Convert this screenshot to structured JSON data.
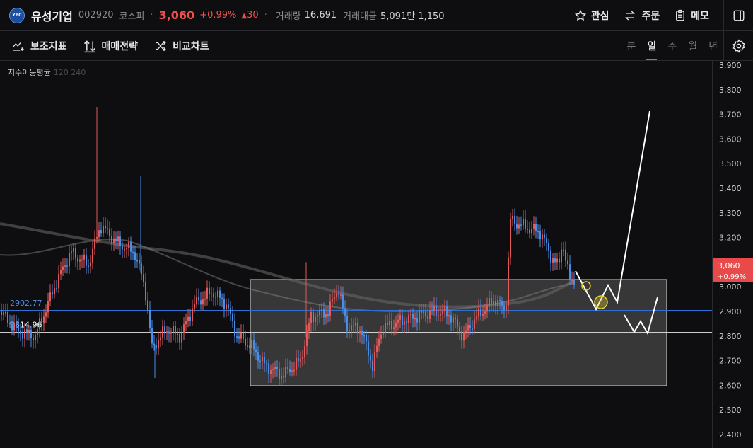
{
  "header": {
    "logo_text": "YPC",
    "name": "유성기업",
    "code": "002920",
    "market": "코스피",
    "price": "3,060",
    "change_pct": "+0.99%",
    "change_abs": "30",
    "volume_label": "거래량",
    "volume_value": "16,691",
    "amount_label": "거래대금",
    "amount_value": "5,091만 1,150",
    "actions": {
      "watch": "관심",
      "order": "주문",
      "memo": "메모"
    }
  },
  "toolbar": {
    "indicator": "보조지표",
    "strategy": "매매전략",
    "compare": "비교차트",
    "periods": [
      "분",
      "일",
      "주",
      "월",
      "년"
    ],
    "active_period": "일"
  },
  "chart": {
    "indicator_label": "지수이동평균",
    "ma_periods": "120 240",
    "y_ticks": [
      2400,
      2500,
      2600,
      2700,
      2800,
      2900,
      3000,
      3100,
      3200,
      3300,
      3400,
      3500,
      3600,
      3700,
      3800,
      3900
    ],
    "y_tick_labels": [
      "2,400",
      "2,500",
      "2,600",
      "2,700",
      "2,800",
      "2,900",
      "3,000",
      "3,100",
      "3,200",
      "3,300",
      "3,400",
      "3,500",
      "3,600",
      "3,700",
      "3,800",
      "3,900"
    ],
    "current_price_label": "3,060",
    "current_change_label": "+0.99%",
    "blue_line_value": 2902.77,
    "blue_line_label": "2902.77",
    "white_line_value": 2814.96,
    "white_line_label": "2814.96",
    "colors": {
      "up": "#e25a5a",
      "down": "#4a8ee8",
      "blue_line": "#2f6fd6",
      "price_tag": "#e84a4a"
    }
  }
}
